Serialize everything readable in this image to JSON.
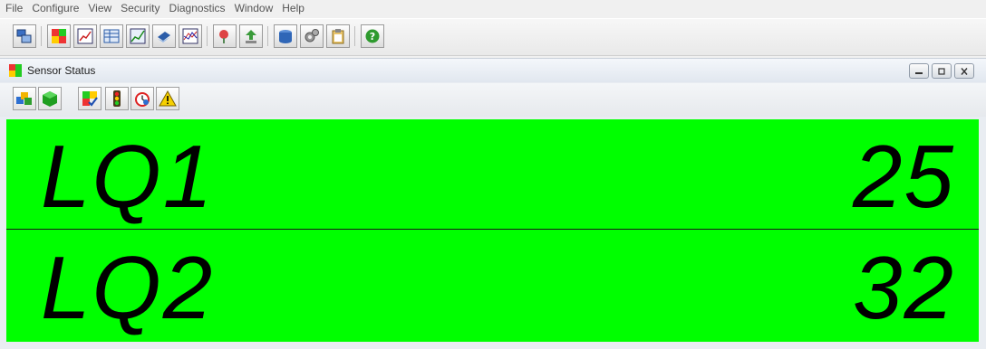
{
  "menu": [
    "File",
    "Configure",
    "View",
    "Security",
    "Diagnostics",
    "Window",
    "Help"
  ],
  "app_toolbar": [
    {
      "icon": "network-computer-icon"
    },
    {
      "icon": "sensor-grid-icon"
    },
    {
      "icon": "chart-report-icon"
    },
    {
      "icon": "table-view-icon"
    },
    {
      "icon": "trend-graph-icon"
    },
    {
      "icon": "book-icon"
    },
    {
      "icon": "multi-trend-icon"
    },
    {
      "icon": "map-pin-icon"
    },
    {
      "icon": "export-icon"
    },
    {
      "icon": "database-icon"
    },
    {
      "icon": "gears-icon"
    },
    {
      "icon": "clipboard-icon"
    },
    {
      "icon": "help-icon"
    }
  ],
  "window": {
    "title": "Sensor Status",
    "controls": [
      "minimize",
      "maximize",
      "close"
    ]
  },
  "child_toolbar": [
    {
      "icon": "cubes-icon"
    },
    {
      "icon": "green-cube-icon"
    },
    {
      "icon": "checklist-icon"
    },
    {
      "icon": "traffic-light-icon"
    },
    {
      "icon": "alarm-clock-icon"
    },
    {
      "icon": "warning-icon"
    }
  ],
  "sensors": [
    {
      "name": "LQ1",
      "value": "25",
      "status_color": "#00ff00"
    },
    {
      "name": "LQ2",
      "value": "32",
      "status_color": "#00ff00"
    }
  ]
}
